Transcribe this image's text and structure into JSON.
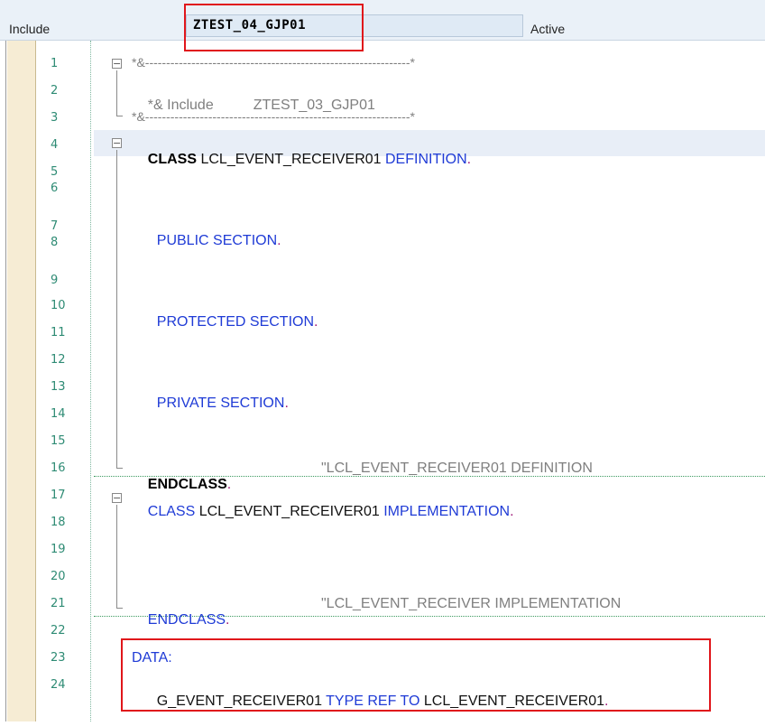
{
  "header": {
    "include_label": "Include",
    "include_value": "ZTEST_04_GJP01",
    "status": "Active"
  },
  "line_numbers": [
    "1",
    "2",
    "3",
    "4",
    "5",
    "6",
    "7",
    "8",
    "9",
    "10",
    "11",
    "12",
    "13",
    "14",
    "15",
    "16",
    "17",
    "18",
    "19",
    "20",
    "21",
    "22",
    "23",
    "24"
  ],
  "code": {
    "l1": "*&---------------------------------------------------------------*",
    "l2_a": "*& Include",
    "l2_b": "ZTEST_03_GJP01",
    "l3": "*&---------------------------------------------------------------*",
    "l4_kw": "CLASS",
    "l4_name": " LCL_EVENT_RECEIVER01 ",
    "l4_def": "DEFINITION",
    "l7": "PUBLIC SECTION",
    "l10": "PROTECTED SECTION",
    "l13": "PRIVATE SECTION",
    "l16_kw": "ENDCLASS",
    "l16_cmt": "\"LCL_EVENT_RECEIVER01 DEFINITION",
    "l17_kw": "CLASS",
    "l17_name": " LCL_EVENT_RECEIVER01 ",
    "l17_impl": "IMPLEMENTATION",
    "l21_kw": "ENDCLASS",
    "l21_cmt": "\"LCL_EVENT_RECEIVER IMPLEMENTATION",
    "l23": "DATA:",
    "l24_a": "G_EVENT_RECEIVER01 ",
    "l24_b": "TYPE REF TO",
    "l24_c": " LCL_EVENT_RECEIVER01",
    "period": "."
  },
  "colors": {
    "keyword_blue": "#1f3bd6",
    "comment_gray": "#7f7f7f",
    "line_number_teal": "#2e8b74",
    "highlight_red": "#e0161b"
  }
}
